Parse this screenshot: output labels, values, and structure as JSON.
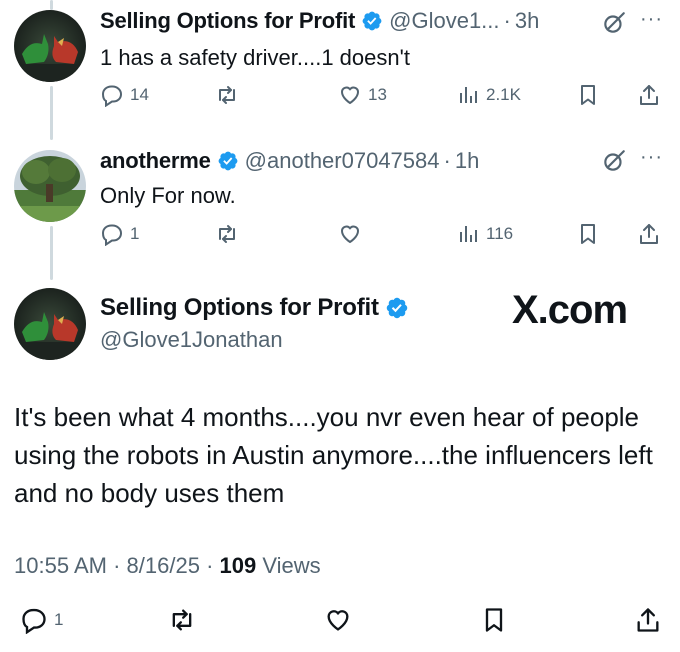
{
  "reply1": {
    "name": "Selling Options for Profit",
    "handle": "@Glove1...",
    "separator": "·",
    "time": "3h",
    "text": "1 has a safety driver....1 doesn't",
    "replies": "14",
    "reposts": "",
    "likes": "13",
    "views": "2.1K",
    "more": "···"
  },
  "reply2": {
    "name": "anotherme",
    "handle": "@another07047584",
    "separator": "·",
    "time": "1h",
    "text": "Only For now.",
    "replies": "1",
    "reposts": "",
    "likes": "",
    "views": "116",
    "more": "···"
  },
  "main": {
    "name": "Selling Options for Profit",
    "handle": "@Glove1Jonathan",
    "watermark": "X.com",
    "text": "It's been what 4 months....you nvr even hear of people using the robots in Austin anymore....the influencers left and no body uses them",
    "time": "10:55 AM",
    "date": "8/16/25",
    "sep": "·",
    "views_count": "109",
    "views_label": "Views",
    "replies": "1"
  },
  "icons": {
    "reply": "reply-icon",
    "repost": "repost-icon",
    "like": "heart-icon",
    "views": "views-icon",
    "bookmark": "bookmark-icon",
    "share": "share-icon",
    "grok": "grok-icon",
    "verified": "verified-badge-icon"
  },
  "colors": {
    "verified_blue": "#1d9bf0",
    "text_primary": "#0f1419",
    "text_secondary": "#536471",
    "thread_line": "#cfd9de"
  }
}
